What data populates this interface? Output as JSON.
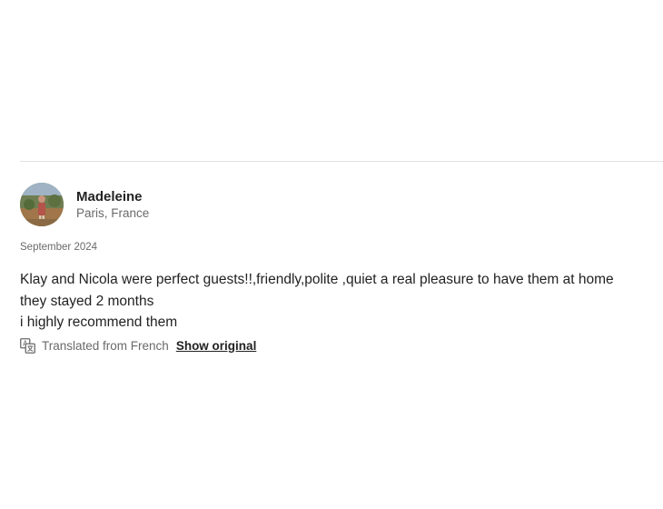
{
  "review": {
    "reviewer_name": "Madeleine",
    "reviewer_location": "Paris, France",
    "date": "September 2024",
    "body_lines": [
      "Klay and Nicola were perfect guests!!,friendly,polite ,quiet a real pleasure to have them at home",
      "they stayed 2 months",
      "i highly recommend them"
    ],
    "translation_note": "Translated from French",
    "show_original_label": "Show original"
  },
  "icons": {
    "avatar": "reviewer-photo",
    "translate": "translate-icon"
  },
  "colors": {
    "text_primary": "#222222",
    "text_secondary": "#6a6a6a",
    "divider": "#e2e2e2"
  }
}
